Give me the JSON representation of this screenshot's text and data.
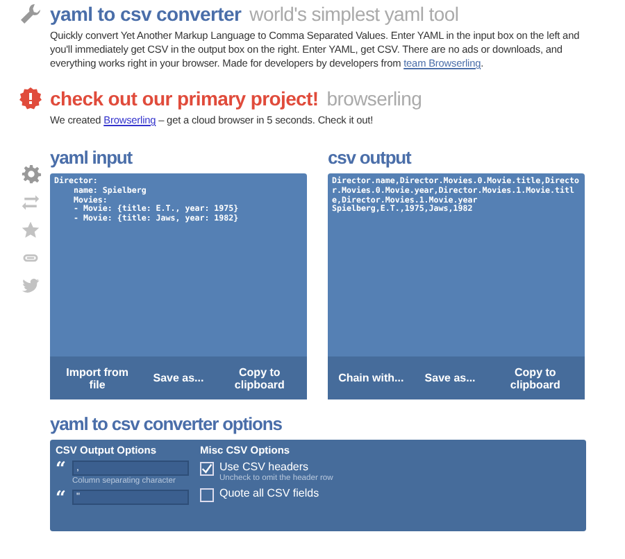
{
  "header": {
    "title": "yaml to csv converter",
    "subtitle": "world's simplest yaml tool",
    "description": "Quickly convert Yet Another Markup Language to Comma Separated Values. Enter YAML in the input box on the left and you'll immediately get CSV in the output box on the right. Enter YAML, get CSV. There are no ads or downloads, and everything works right in your browser. Made for developers by developers from ",
    "link": "team Browserling",
    "after": "."
  },
  "promo": {
    "title": "check out our primary project!",
    "subtitle": "browserling",
    "before": "We created ",
    "link": "Browserling",
    "after": " – get a cloud browser in 5 seconds. Check it out!"
  },
  "panels": [
    {
      "title": "yaml input",
      "text": "Director:\n    name: Spielberg\n    Movies:\n    - Movie: {title: E.T., year: 1975}\n    - Movie: {title: Jaws, year: 1982}",
      "buttons": [
        "Import from file",
        "Save as...",
        "Copy to clipboard"
      ]
    },
    {
      "title": "csv output",
      "text": "Director.name,Director.Movies.0.Movie.title,Director.Movies.0.Movie.year,Director.Movies.1.Movie.title,Director.Movies.1.Movie.year\nSpielberg,E.T.,1975,Jaws,1982",
      "buttons": [
        "Chain with...",
        "Save as...",
        "Copy to clipboard"
      ]
    }
  ],
  "options": {
    "title": "yaml to csv converter options",
    "groups": [
      {
        "title": "CSV Output Options",
        "fields": [
          {
            "quote": "“",
            "value": ",",
            "hint": "Column separating character"
          },
          {
            "quote": "“",
            "value": "\""
          }
        ]
      },
      {
        "title": "Misc CSV Options",
        "checkboxes": [
          {
            "label": "Use CSV headers",
            "hint": "Uncheck to omit the header row",
            "checked": true
          },
          {
            "label": "Quote all CSV fields",
            "checked": false
          }
        ]
      }
    ]
  }
}
